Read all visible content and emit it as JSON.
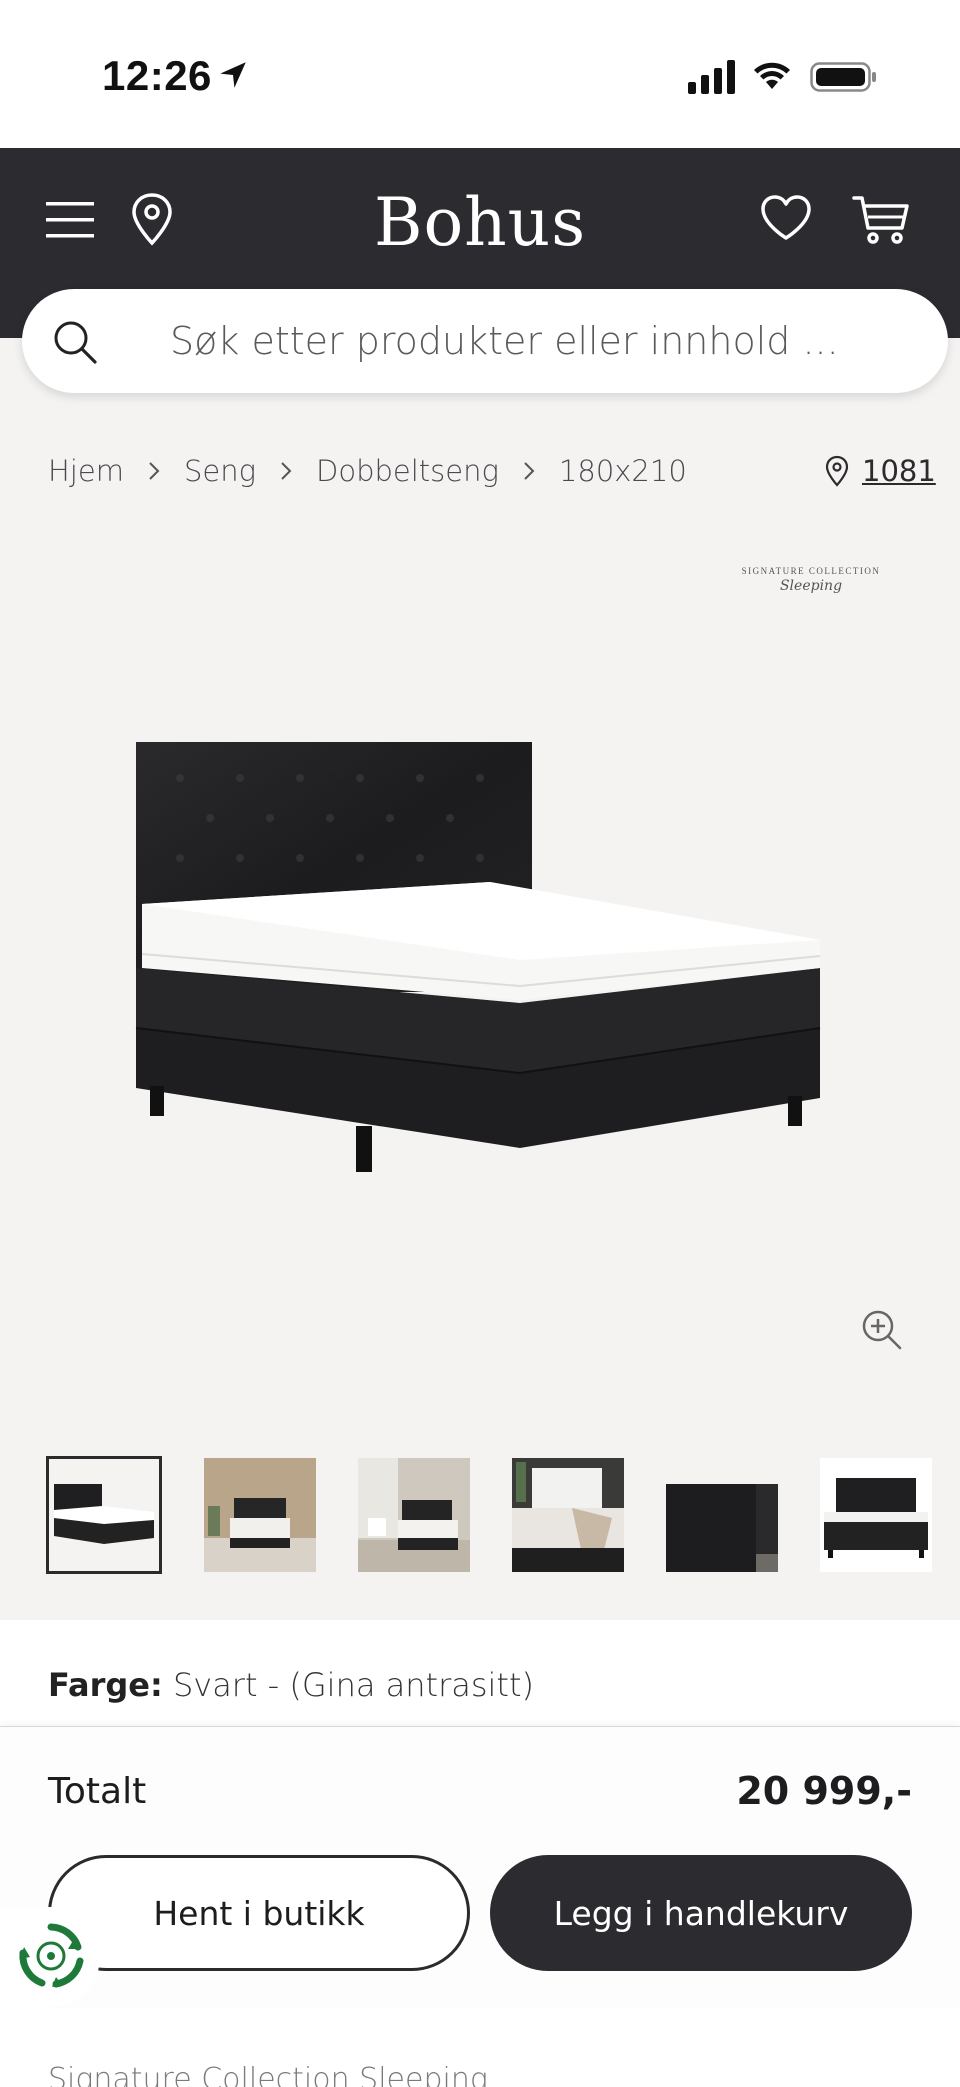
{
  "status_bar": {
    "time": "12:26"
  },
  "header": {
    "logo": "Bohus",
    "icons": [
      "menu-icon",
      "location-pin-icon",
      "heart-icon",
      "cart-icon"
    ],
    "background": "#2c2c30"
  },
  "search": {
    "placeholder": "Søk etter produkter eller innhold ..."
  },
  "breadcrumb": {
    "items": [
      "Hjem",
      "Seng",
      "Dobbeltseng",
      "180x210"
    ]
  },
  "store": {
    "label": "1081"
  },
  "brand_badge": {
    "line1": "SIGNATURE COLLECTION",
    "line2": "Sleeping"
  },
  "gallery": {
    "thumbnail_count": 6,
    "selected_index": 0
  },
  "product": {
    "color_label": "Farge:",
    "color_value": "Svart - (Gina antrasitt)"
  },
  "purchase": {
    "total_label": "Totalt",
    "total_price": "20 999,-",
    "pickup_button": "Hent i butikk",
    "add_to_cart_button": "Legg i handlekurv"
  },
  "footer": {
    "peek_text": "Signature Collection Sleeping"
  },
  "colors": {
    "header_bg": "#2c2c30",
    "gallery_bg": "#f4f3f2",
    "eco_green": "#1f7a3a"
  }
}
